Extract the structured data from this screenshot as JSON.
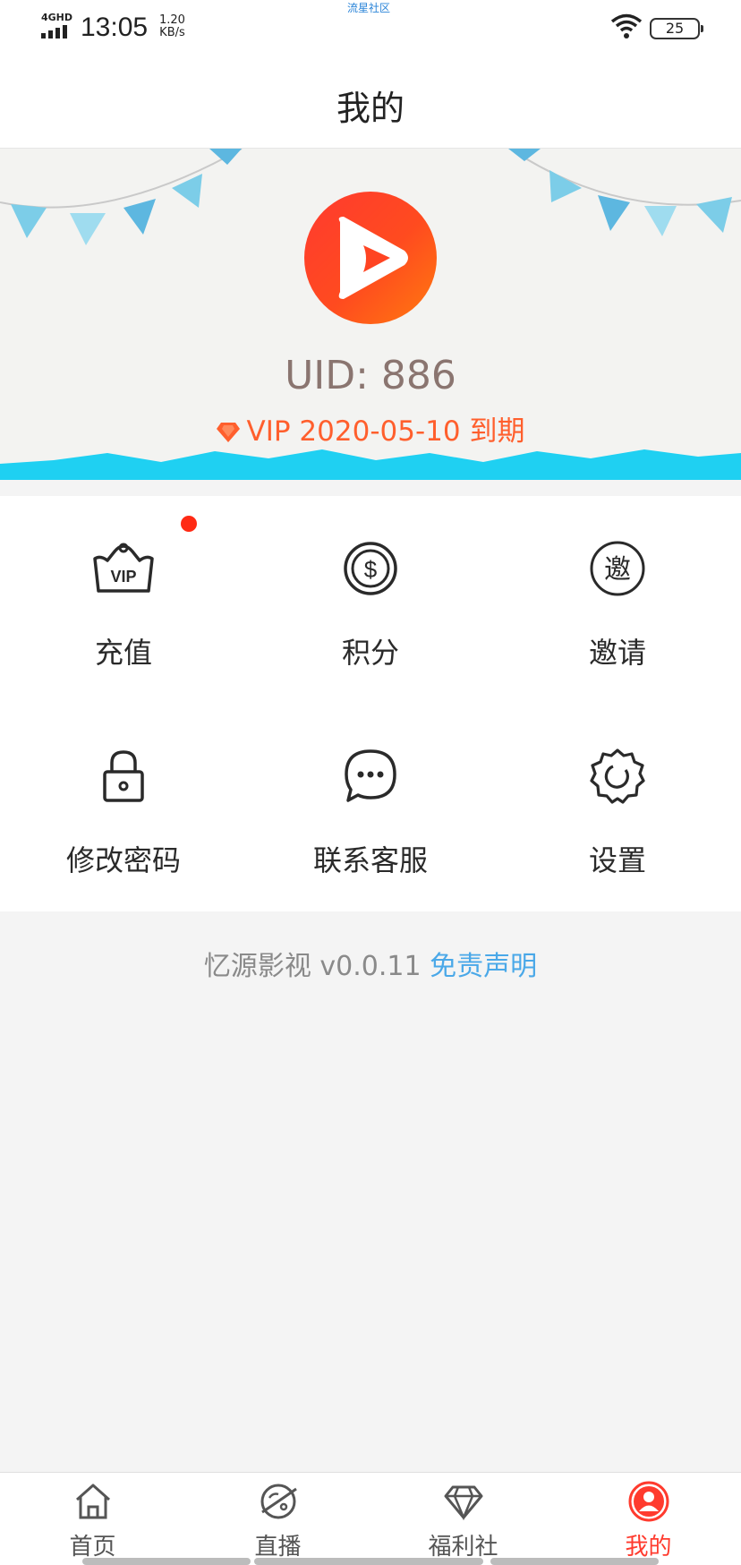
{
  "status_bar": {
    "network": "4GHD",
    "time": "13:05",
    "speed_value": "1.20",
    "speed_unit": "KB/s",
    "watermark": "流星社区",
    "battery": "25",
    "icons": [
      "signal-icon",
      "wifi-icon",
      "battery-icon"
    ]
  },
  "header": {
    "title": "我的"
  },
  "profile": {
    "uid": "UID: 886",
    "vip_text": "VIP 2020-05-10 到期",
    "icons": [
      "app-logo-icon",
      "gem-icon"
    ]
  },
  "menu": [
    {
      "label": "充值",
      "icon": "vip-crown-icon",
      "has_dot": true
    },
    {
      "label": "积分",
      "icon": "dollar-coin-icon"
    },
    {
      "label": "邀请",
      "icon": "invite-icon",
      "icon_text": "邀"
    },
    {
      "label": "修改密码",
      "icon": "lock-icon"
    },
    {
      "label": "联系客服",
      "icon": "chat-icon"
    },
    {
      "label": "设置",
      "icon": "gear-icon"
    }
  ],
  "footer": {
    "version_text": "忆源影视 v0.0.11 ",
    "disclaimer_link": "免责声明"
  },
  "tabbar": {
    "active": "我的",
    "tabs": [
      {
        "label": "首页",
        "icon": "home-icon"
      },
      {
        "label": "直播",
        "icon": "planet-icon"
      },
      {
        "label": "福利社",
        "icon": "diamond-icon"
      },
      {
        "label": "我的",
        "icon": "user-icon"
      }
    ]
  },
  "colors": {
    "accent": "#ff3b2e",
    "vip_text": "#ff5f2d",
    "link": "#4aa8e8",
    "banner_wave": "#1fd0f2"
  }
}
